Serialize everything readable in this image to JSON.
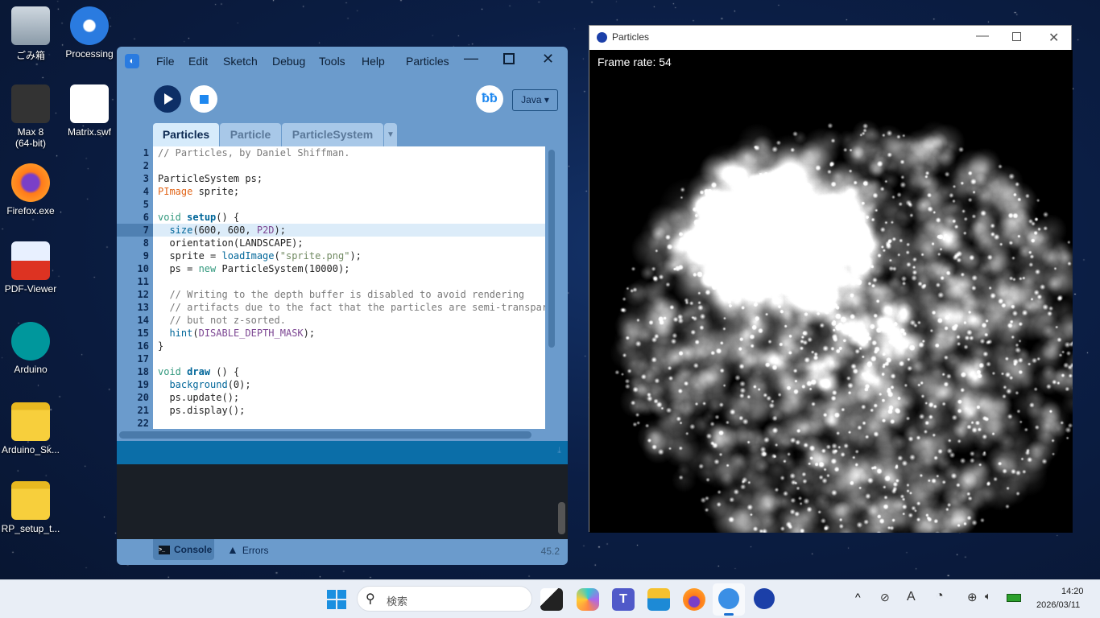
{
  "desktop": {
    "icons": [
      {
        "label": "ごみ箱",
        "icon": "recycle-bin-icon"
      },
      {
        "label": "Processing",
        "icon": "processing-icon"
      },
      {
        "label": "Max 8\n(64-bit)",
        "icon": "max-icon"
      },
      {
        "label": "Matrix.swf",
        "icon": "file-icon"
      },
      {
        "label": "Firefox.exe",
        "icon": "firefox-icon"
      },
      {
        "label": "PDF-Viewer",
        "icon": "pdf-icon"
      },
      {
        "label": "Arduino",
        "icon": "arduino-icon"
      },
      {
        "label": "Arduino_Sk...",
        "icon": "folder-icon"
      },
      {
        "label": "RP_setup_t...",
        "icon": "folder-icon"
      }
    ]
  },
  "ide": {
    "menu": [
      "File",
      "Edit",
      "Sketch",
      "Debug",
      "Tools",
      "Help"
    ],
    "title": "Particles",
    "mode": "Java ▾",
    "tabs": [
      "Particles",
      "Particle",
      "ParticleSystem"
    ],
    "active_tab": "Particles",
    "current_line": 7,
    "code": [
      [
        [
          "// Particles, by Daniel Shiffman.",
          "com"
        ]
      ],
      [],
      [
        [
          "ParticleSystem ps;",
          ""
        ]
      ],
      [
        [
          "PImage",
          "type"
        ],
        [
          " sprite;",
          ""
        ]
      ],
      [],
      [
        [
          "void",
          "kw"
        ],
        [
          " ",
          ""
        ],
        [
          "setup",
          "fn"
        ],
        [
          "() {",
          ""
        ]
      ],
      [
        [
          "  ",
          ""
        ],
        [
          "size",
          "call"
        ],
        [
          "(600, 600, ",
          ""
        ],
        [
          "P2D",
          "str"
        ],
        [
          ");",
          ""
        ]
      ],
      [
        [
          "  orientation(LANDSCAPE);",
          ""
        ]
      ],
      [
        [
          "  sprite = ",
          ""
        ],
        [
          "loadImage",
          "call"
        ],
        [
          "(",
          ""
        ],
        [
          "\"sprite.png\"",
          "const"
        ],
        [
          ");",
          ""
        ]
      ],
      [
        [
          "  ps = ",
          ""
        ],
        [
          "new",
          "kw"
        ],
        [
          " ParticleSystem(10000);",
          ""
        ]
      ],
      [],
      [
        [
          "  // Writing to the depth buffer is disabled to avoid rendering",
          "com"
        ]
      ],
      [
        [
          "  // artifacts due to the fact that the particles are semi-transparent",
          "com"
        ]
      ],
      [
        [
          "  // but not z-sorted.",
          "com"
        ]
      ],
      [
        [
          "  ",
          ""
        ],
        [
          "hint",
          "call"
        ],
        [
          "(",
          ""
        ],
        [
          "DISABLE_DEPTH_MASK",
          "str"
        ],
        [
          ");",
          ""
        ]
      ],
      [
        [
          "}",
          ""
        ]
      ],
      [],
      [
        [
          "void",
          "kw"
        ],
        [
          " ",
          ""
        ],
        [
          "draw",
          "fn"
        ],
        [
          " () {",
          ""
        ]
      ],
      [
        [
          "  ",
          ""
        ],
        [
          "background",
          "call"
        ],
        [
          "(0);",
          ""
        ]
      ],
      [
        [
          "  ps.update();",
          ""
        ]
      ],
      [
        [
          "  ps.display();",
          ""
        ]
      ],
      []
    ],
    "console_tab": "Console",
    "errors_tab": "Errors",
    "version": "45.2"
  },
  "sketch": {
    "title": "Particles",
    "frame_rate_label": "Frame rate: 54"
  },
  "taskbar": {
    "search_placeholder": "検索",
    "time": "14:20",
    "date": "2026/03/11"
  },
  "colors": {
    "ide_bg": "#6b9bcc",
    "accent": "#0b6ea8",
    "play": "#0d2f66"
  }
}
